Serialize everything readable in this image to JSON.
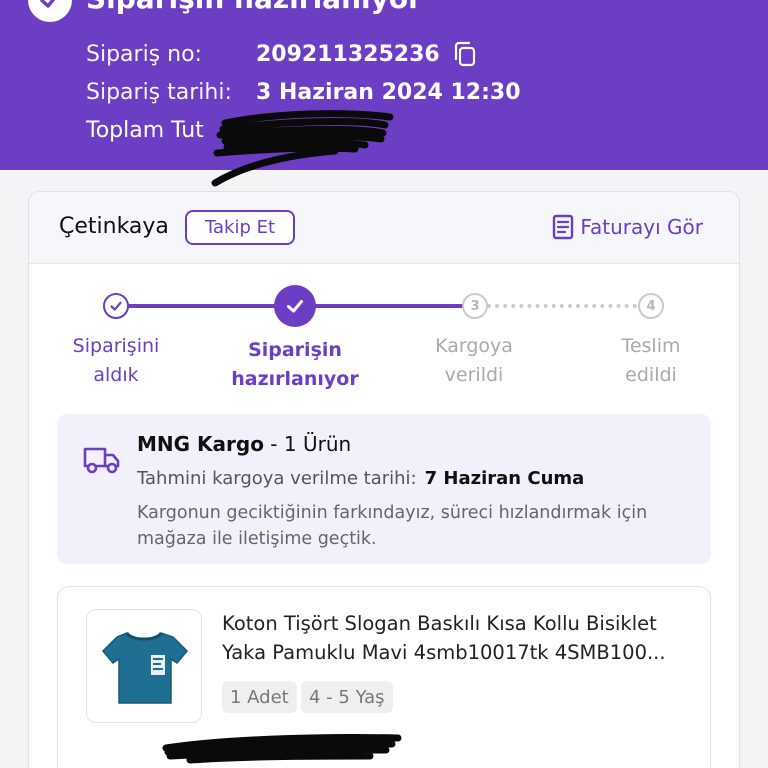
{
  "header": {
    "title": "Siparişin hazırlanıyor",
    "order_no_label": "Sipariş no:",
    "order_no": "209211325236",
    "order_date_label": "Sipariş tarihi:",
    "order_date": "3 Haziran 2024 12:30",
    "total_label": "Toplam Tut"
  },
  "seller": {
    "name": "Çetinkaya",
    "follow_label": "Takip Et",
    "invoice_label": "Faturayı Gör"
  },
  "steps": [
    {
      "line1": "Siparişini",
      "line2": "aldık",
      "state": "done",
      "number": ""
    },
    {
      "line1": "Siparişin",
      "line2": "hazırlanıyor",
      "state": "active",
      "number": ""
    },
    {
      "line1": "Kargoya",
      "line2": "verildi",
      "state": "todo",
      "number": "3"
    },
    {
      "line1": "Teslim",
      "line2": "edildi",
      "state": "todo",
      "number": "4"
    }
  ],
  "shipment": {
    "carrier": "MNG Kargo",
    "count": " - 1 Ürün",
    "date_label": "Tahmini kargoya verilme tarihi:",
    "date_value": "7 Haziran Cuma",
    "note": "Kargonun geciktiğinin farkındayız, süreci hızlandırmak için mağaza ile iletişime geçtik."
  },
  "product": {
    "title_line1": "Koton Tişört Slogan Baskılı Kısa Kollu Bisiklet",
    "title_line2": "Yaka Pamuklu Mavi 4smb10017tk 4SMB100...",
    "quantity": "1 Adet",
    "size": "4 - 5 Yaş"
  },
  "colors": {
    "brand": "#6b3ec4",
    "inactive": "#c9c9cf"
  }
}
